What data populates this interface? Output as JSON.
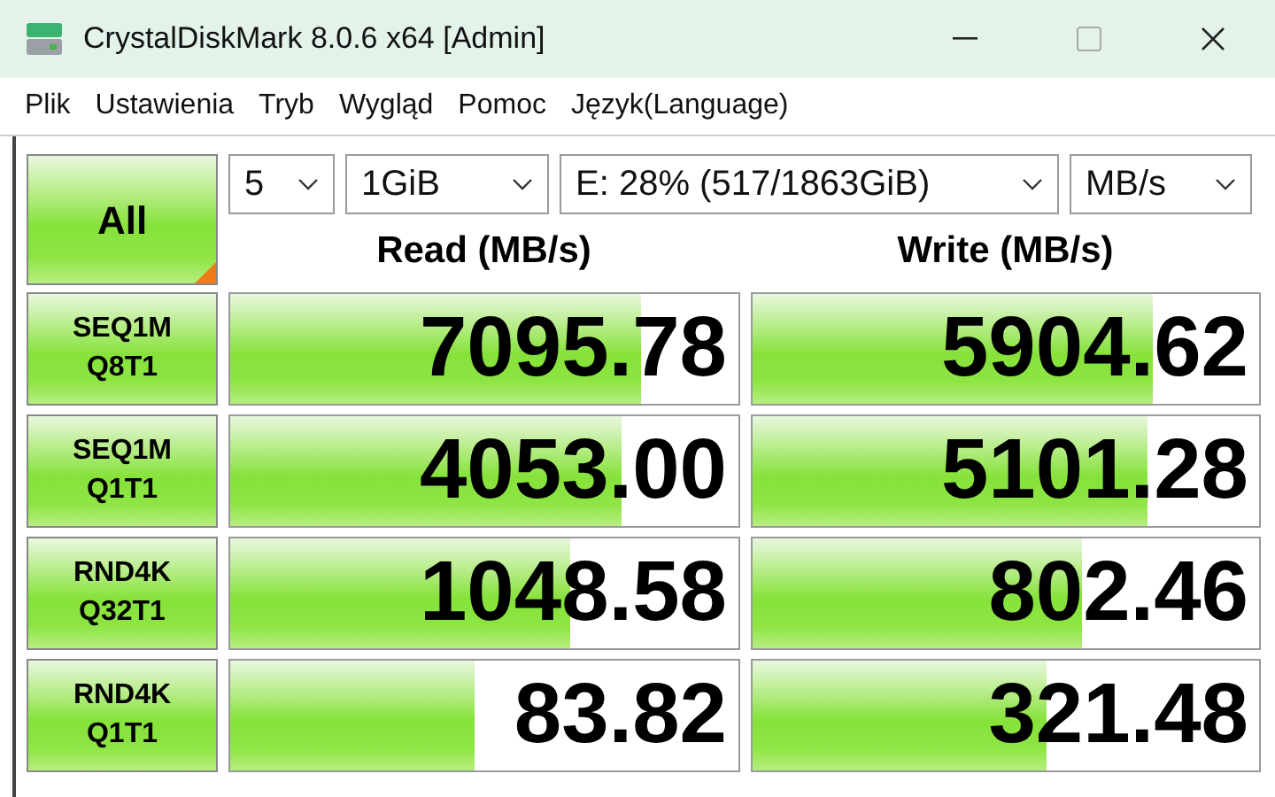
{
  "window": {
    "title": "CrystalDiskMark 8.0.6 x64 [Admin]"
  },
  "menu": [
    "Plik",
    "Ustawienia",
    "Tryb",
    "Wygląd",
    "Pomoc",
    "Język(Language)"
  ],
  "all_button": {
    "label": "All"
  },
  "selects": [
    {
      "value": "5"
    },
    {
      "value": "1GiB"
    },
    {
      "value": "E: 28% (517/1863GiB)"
    },
    {
      "value": "MB/s"
    }
  ],
  "headers": [
    "Read (MB/s)",
    "Write (MB/s)"
  ],
  "tests": [
    {
      "label": [
        "SEQ1M",
        "Q8T1"
      ],
      "read": {
        "value": "7095.78",
        "level": 0.81
      },
      "write": {
        "value": "5904.62",
        "level": 0.79
      }
    },
    {
      "label": [
        "SEQ1M",
        "Q1T1"
      ],
      "read": {
        "value": "4053.00",
        "level": 0.77
      },
      "write": {
        "value": "5101.28",
        "level": 0.78
      }
    },
    {
      "label": [
        "RND4K",
        "Q32T1"
      ],
      "read": {
        "value": "1048.58",
        "level": 0.67
      },
      "write": {
        "value": "802.46",
        "level": 0.65
      }
    },
    {
      "label": [
        "RND4K",
        "Q1T1"
      ],
      "read": {
        "value": "83.82",
        "level": 0.48
      },
      "write": {
        "value": "321.48",
        "level": 0.58
      }
    }
  ]
}
